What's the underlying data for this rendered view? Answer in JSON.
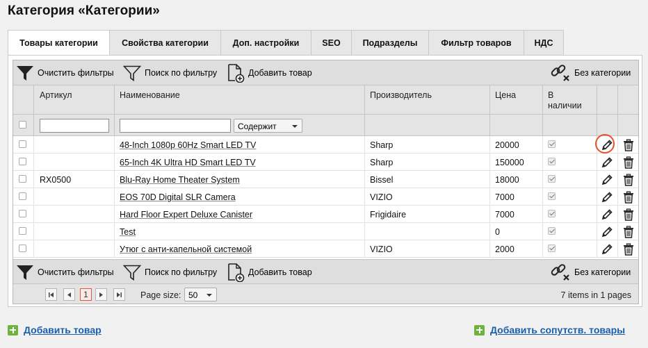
{
  "page": {
    "title": "Категория «Категории»"
  },
  "tabs": [
    {
      "label": "Товары категории"
    },
    {
      "label": "Свойства категории"
    },
    {
      "label": "Доп. настройки"
    },
    {
      "label": "SEO"
    },
    {
      "label": "Подразделы"
    },
    {
      "label": "Фильтр товаров"
    },
    {
      "label": "НДС"
    }
  ],
  "toolbar": {
    "clear_filters": "Очистить фильтры",
    "search_filter": "Поиск по фильтру",
    "add_product": "Добавить товар",
    "no_category": "Без категории"
  },
  "columns": {
    "sku": "Артикул",
    "name": "Наименование",
    "manufacturer": "Производитель",
    "price": "Цена",
    "in_stock_line1": "В",
    "in_stock_line2": "наличии"
  },
  "filter": {
    "sku_value": "",
    "name_value": "",
    "mode": "Содержит"
  },
  "rows": [
    {
      "sku": "",
      "name": "48-Inch 1080p 60Hz Smart LED TV",
      "manufacturer": "Sharp",
      "price": "20000",
      "in_stock": true
    },
    {
      "sku": "",
      "name": "65-Inch 4K Ultra HD Smart LED TV",
      "manufacturer": "Sharp",
      "price": "150000",
      "in_stock": true
    },
    {
      "sku": "RX0500",
      "name": "Blu-Ray Home Theater System",
      "manufacturer": "Bissel",
      "price": "18000",
      "in_stock": true
    },
    {
      "sku": "",
      "name": "EOS 70D Digital SLR Camera",
      "manufacturer": "VIZIO",
      "price": "7000",
      "in_stock": true
    },
    {
      "sku": "",
      "name": "Hard Floor Expert Deluxe Canister",
      "manufacturer": "Frigidaire",
      "price": "7000",
      "in_stock": true
    },
    {
      "sku": "",
      "name": "Test",
      "manufacturer": "",
      "price": "0",
      "in_stock": true
    },
    {
      "sku": "",
      "name": "Утюг с анти-капельной системой",
      "manufacturer": "VIZIO",
      "price": "2000",
      "in_stock": true
    }
  ],
  "pager": {
    "current_page": "1",
    "page_size_label": "Page size:",
    "page_size": "50",
    "summary": "7 items in 1 pages"
  },
  "footer": {
    "add_product": "Добавить товар",
    "add_related": "Добавить сопутств. товары"
  },
  "colors": {
    "accent_link": "#1a5fa8",
    "plus_green": "#6cb33f",
    "highlight": "#e8502a"
  }
}
